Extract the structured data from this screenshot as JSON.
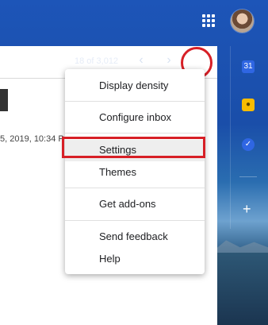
{
  "header": {
    "apps_icon": "apps-grid-icon",
    "avatar": "account-avatar"
  },
  "toolbar": {
    "pager_text": "18 of 3,012",
    "prev_icon": "chevron-left-icon",
    "next_icon": "chevron-right-icon",
    "settings_icon": "gear-icon",
    "prev_glyph": "‹",
    "next_glyph": "›",
    "gear_glyph": "⚙"
  },
  "email": {
    "date_text": "5, 2019, 10:34 P"
  },
  "settings_menu": {
    "items": [
      {
        "label": "Display density"
      },
      {
        "label": "Configure inbox"
      },
      {
        "label": "Settings"
      },
      {
        "label": "Themes"
      },
      {
        "label": "Get add-ons"
      },
      {
        "label": "Send feedback"
      },
      {
        "label": "Help"
      }
    ]
  },
  "side_panel": {
    "calendar_label": "31",
    "keep_icon": "keep-bulb-icon",
    "tasks_icon": "tasks-check-icon",
    "add_label": "+"
  },
  "colors": {
    "accent_blue": "#1a4ea9",
    "highlight_red": "#d71f26",
    "menu_text": "#202124"
  }
}
